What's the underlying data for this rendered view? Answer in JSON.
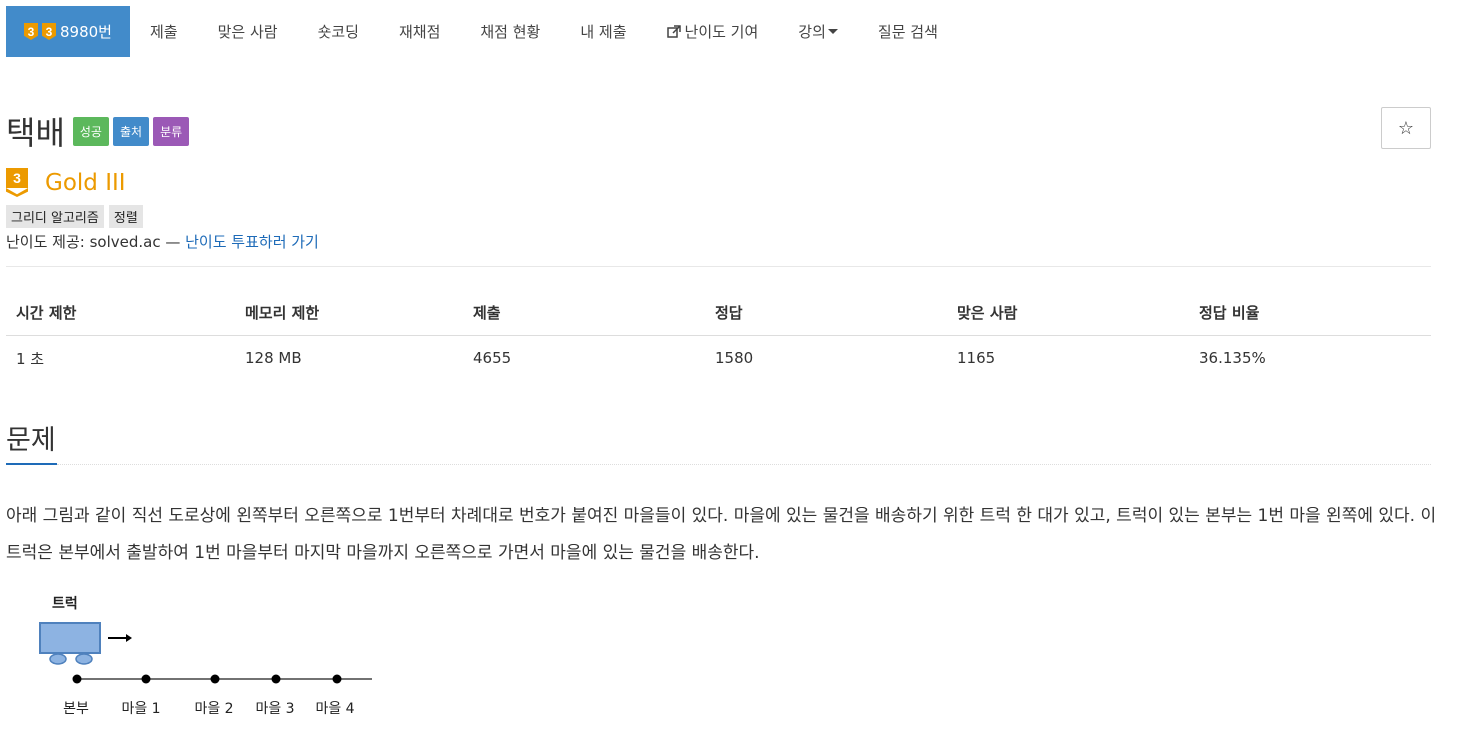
{
  "nav": {
    "problem_id_label": "8980번",
    "badge_digit_1": "3",
    "badge_digit_2": "3",
    "items": [
      "제출",
      "맞은 사람",
      "숏코딩",
      "재채점",
      "채점 현황",
      "내 제출",
      "난이도 기여",
      "강의",
      "질문 검색"
    ]
  },
  "problem": {
    "title": "택배",
    "labels": [
      "성공",
      "출처",
      "분류"
    ],
    "star": "☆",
    "level_digit": "3",
    "level_text": "Gold III",
    "tags": [
      "그리디 알고리즘",
      "정렬"
    ],
    "provider_prefix": "난이도 제공: solved.ac — ",
    "provider_link": "난이도 투표하러 가기"
  },
  "stats": {
    "headers": [
      "시간 제한",
      "메모리 제한",
      "제출",
      "정답",
      "맞은 사람",
      "정답 비율"
    ],
    "values": [
      "1 초",
      "128 MB",
      "4655",
      "1580",
      "1165",
      "36.135%"
    ]
  },
  "section": {
    "title": "문제",
    "paragraph_1": "아래 그림과 같이 직선 도로상에 왼쪽부터 오른쪽으로 1번부터 차례대로 번호가 붙여진 마을들이 있다. 마을에 있는 물건을 배송하기 위한 트럭 한 대가 있고, 트럭이 있는 본부는 1번 마을 왼쪽에 있다. 이 트럭은 본부에서 출발하여 1번 마을부터 마지막 마을까지 오른쪽으로 가면서 마을에 있는 물건을 배송한다."
  },
  "diagram": {
    "truck_label": "트럭",
    "stops": [
      "본부",
      "마을 1",
      "마을 2",
      "마을 3",
      "마을 4"
    ],
    "truck_color": "#8db3e2"
  },
  "colors": {
    "accent": "#428bca",
    "gold": "#ec9a00",
    "success": "#5cb85c",
    "category": "#9b59b6",
    "link": "#1e6bb8"
  }
}
